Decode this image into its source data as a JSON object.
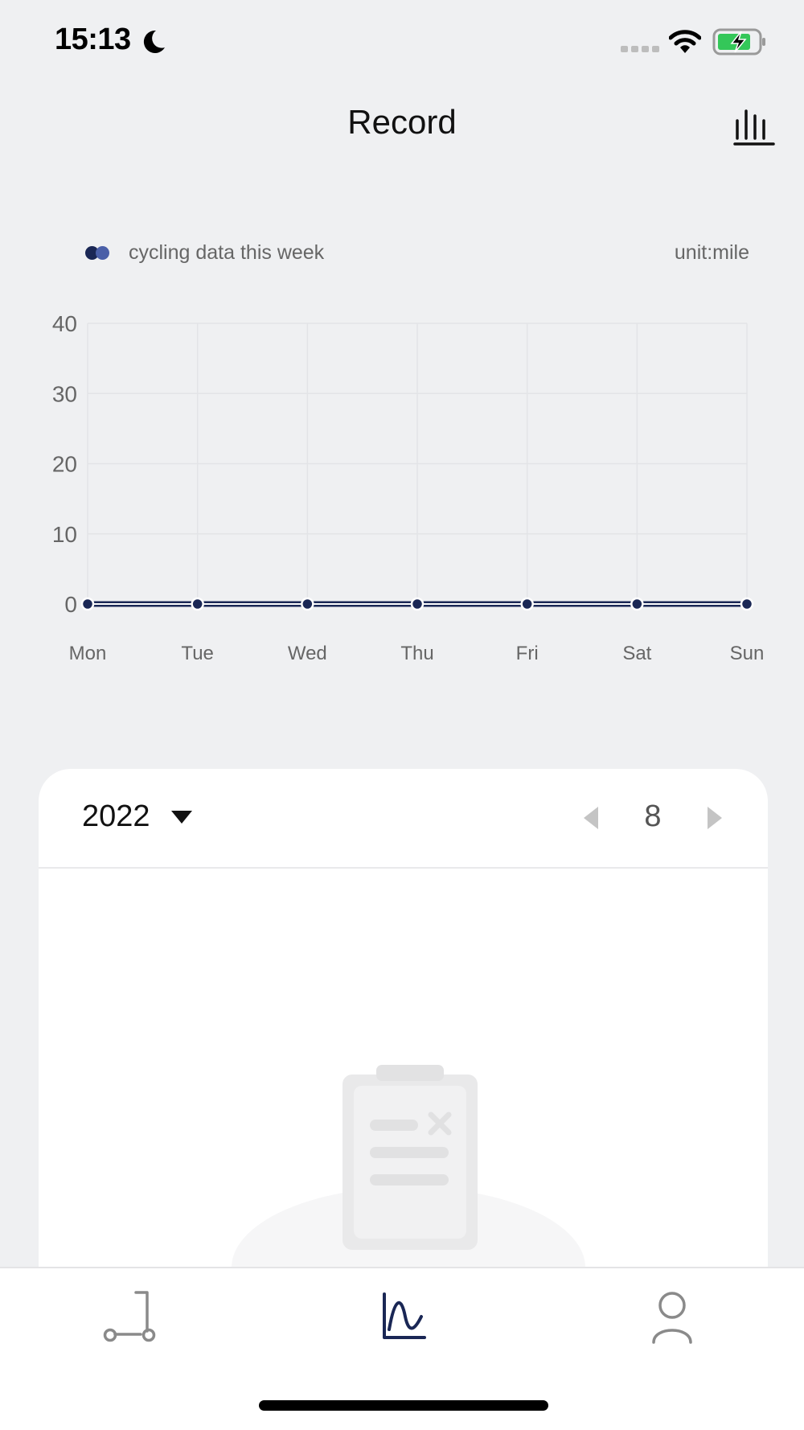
{
  "status_bar": {
    "time": "15:13",
    "icons": [
      "moon-icon",
      "signal-icon",
      "wifi-icon",
      "battery-charging-icon"
    ]
  },
  "header": {
    "title": "Record",
    "action_icon": "bar-chart-icon"
  },
  "chart": {
    "legend": "cycling data this week",
    "unit": "unit:mile"
  },
  "chart_data": {
    "type": "line",
    "categories": [
      "Mon",
      "Tue",
      "Wed",
      "Thu",
      "Fri",
      "Sat",
      "Sun"
    ],
    "series": [
      {
        "values": [
          0,
          0,
          0,
          0,
          0,
          0,
          0
        ]
      }
    ],
    "yticks": [
      "0",
      "10",
      "20",
      "30",
      "40"
    ],
    "ylim": [
      0,
      40
    ],
    "grid": true,
    "legend_position": "top-left",
    "colors": {
      "line": "#1a2755",
      "line_secondary": "#4a5fa8",
      "grid": "#e3e4e7",
      "tick_text": "#666666"
    }
  },
  "records_card": {
    "year": "2022",
    "month": "8",
    "empty_state_icon": "empty-clipboard-icon"
  },
  "tab_bar": {
    "tabs": [
      {
        "icon": "scooter-icon",
        "active": false
      },
      {
        "icon": "line-chart-icon",
        "active": true
      },
      {
        "icon": "user-icon",
        "active": false
      }
    ],
    "colors": {
      "active": "#1a2755",
      "inactive": "#8a8a8a"
    }
  }
}
